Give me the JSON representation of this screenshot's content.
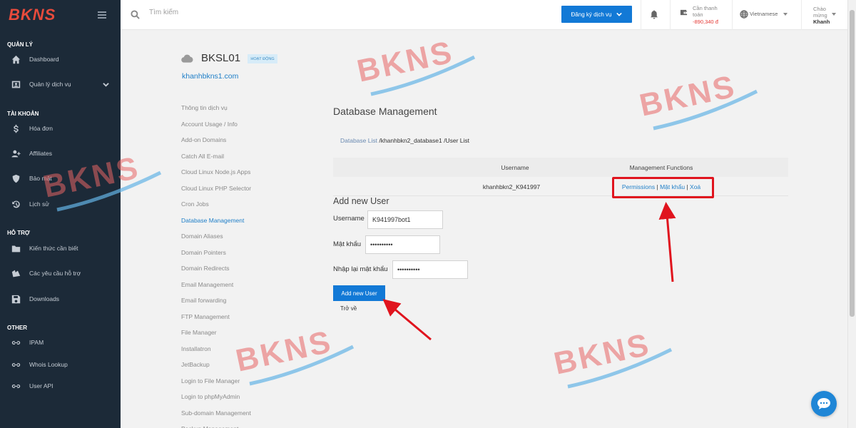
{
  "brand": {
    "logo_text": "BKNS"
  },
  "sidebar": {
    "sections": [
      {
        "title": "QUẢN LÝ"
      },
      {
        "title": "TÀI KHOẢN"
      },
      {
        "title": "HỖ TRỢ"
      },
      {
        "title": "OTHER"
      }
    ],
    "items": [
      {
        "label": "Dashboard",
        "icon": "home-icon"
      },
      {
        "label": "Quản lý dịch vụ",
        "icon": "id-card-icon"
      },
      {
        "label": "Hóa đơn",
        "icon": "dollar-icon"
      },
      {
        "label": "Affiliates",
        "icon": "user-plus-icon"
      },
      {
        "label": "Bảo mật",
        "icon": "shield-icon"
      },
      {
        "label": "Lịch sử",
        "icon": "history-icon"
      },
      {
        "label": "Kiến thức cần biết",
        "icon": "folder-icon"
      },
      {
        "label": "Các yêu cầu hỗ trợ",
        "icon": "ticket-icon"
      },
      {
        "label": "Downloads",
        "icon": "save-icon"
      },
      {
        "label": "IPAM",
        "icon": "link-icon"
      },
      {
        "label": "Whois Lookup",
        "icon": "link-icon"
      },
      {
        "label": "User API",
        "icon": "link-icon"
      }
    ]
  },
  "topbar": {
    "search_placeholder": "Tìm kiếm",
    "register_label": "Đăng ký dịch vụ",
    "payment_label": "Cần thanh toán",
    "payment_amount": "-890,340 đ",
    "language": "Vietnamese",
    "greeting": "Chào mừng",
    "user_name": "Khanh"
  },
  "service": {
    "name": "BKSL01",
    "status": "HOẠT ĐỘNG",
    "domain": "khanhbkns1.com",
    "menu": [
      "Thông tin dịch vụ",
      "Account Usage / Info",
      "Add-on Domains",
      "Catch All E-mail",
      "Cloud Linux Node.js Apps",
      "Cloud Linux PHP Selector",
      "Cron Jobs",
      "Database Management",
      "Domain Aliases",
      "Domain Pointers",
      "Domain Redirects",
      "Email Management",
      "Email forwarding",
      "FTP Management",
      "File Manager",
      "Installatron",
      "JetBackup",
      "Login to File Manager",
      "Login to phpMyAdmin",
      "Sub-domain Management",
      "Backup Management"
    ],
    "active_menu": "Database Management"
  },
  "main": {
    "heading": "Database Management",
    "breadcrumb": {
      "link": "Database List",
      "rest": " /khanhbkn2_database1 /User List"
    },
    "table": {
      "columns": [
        "Username",
        "Management Functions"
      ],
      "rows": [
        {
          "username": "khanhbkn2_K941997",
          "functions": [
            "Permissions",
            "Mật khẩu",
            "Xoá"
          ]
        }
      ]
    },
    "form": {
      "title": "Add new User",
      "username_label": "Username",
      "username_value": "K941997bot1",
      "password_label": "Mật khẩu",
      "password_value": "••••••••••",
      "confirm_label": "Nhập lại mật khẩu",
      "confirm_value": "••••••••••",
      "submit_label": "Add new User",
      "back_label": "Trở về"
    }
  },
  "watermark": {
    "text": "BKNS"
  },
  "colors": {
    "sidebar": "#1c2a38",
    "primary": "#1279d6",
    "highlight": "#e0141e",
    "link": "#1f7fc8"
  }
}
